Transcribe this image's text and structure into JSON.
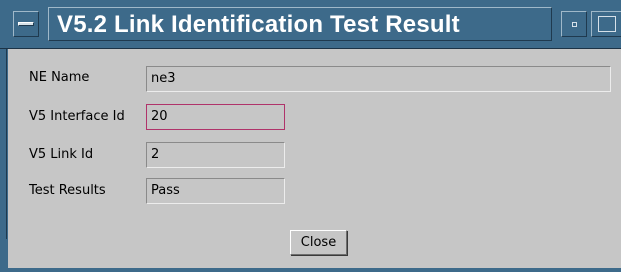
{
  "window": {
    "title": "V5.2 Link Identification Test Result",
    "title_bar_color": "#3d6a8a",
    "background_color": "#c6c6c6"
  },
  "form": {
    "fields": [
      {
        "label": "NE Name",
        "value": "ne3"
      },
      {
        "label": "V5 Interface Id",
        "value": "20"
      },
      {
        "label": "V5 Link Id",
        "value": "2"
      },
      {
        "label": "Test Results",
        "value": "Pass"
      }
    ]
  },
  "actions": {
    "close_label": "Close"
  }
}
